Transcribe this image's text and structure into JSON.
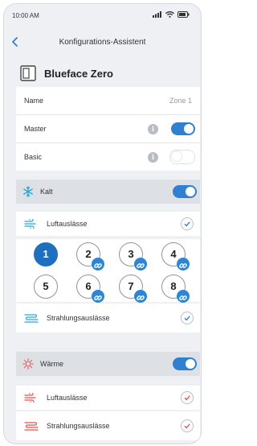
{
  "status_bar": {
    "time": "10:00 AM",
    "icons": [
      "signal-icon",
      "wifi-icon",
      "battery-icon"
    ]
  },
  "nav": {
    "back_icon": "chevron-left-icon",
    "title": "Konfigurations-Assistent"
  },
  "device": {
    "icon": "device-panel-icon",
    "name": "Blueface Zero"
  },
  "settings": {
    "name_label": "Name",
    "name_value": "Zone 1",
    "master_label": "Master",
    "master_on": true,
    "basic_label": "Basic",
    "basic_on": false,
    "info_glyph": "i"
  },
  "cold": {
    "icon": "snowflake-icon",
    "label": "Kalt",
    "enabled": true,
    "air_outlets_label": "Luftauslässe",
    "air_outlets_checked": true,
    "radiant_outlets_label": "Strahlungsauslässe",
    "radiant_outlets_checked": true,
    "zones": [
      {
        "number": "1",
        "selected": true,
        "linked": false
      },
      {
        "number": "2",
        "selected": false,
        "linked": true
      },
      {
        "number": "3",
        "selected": false,
        "linked": true
      },
      {
        "number": "4",
        "selected": false,
        "linked": true
      },
      {
        "number": "5",
        "selected": false,
        "linked": false
      },
      {
        "number": "6",
        "selected": false,
        "linked": true
      },
      {
        "number": "7",
        "selected": false,
        "linked": true
      },
      {
        "number": "8",
        "selected": false,
        "linked": true
      }
    ]
  },
  "warm": {
    "icon": "sun-icon",
    "label": "Wärme",
    "enabled": true,
    "air_outlets_label": "Luftauslässe",
    "air_outlets_checked": true,
    "radiant_outlets_label": "Strahlungsauslässe",
    "radiant_outlets_checked": true
  },
  "colors": {
    "accent": "#2f80d1",
    "cold": "#29a7d8",
    "warm": "#e8504a"
  }
}
